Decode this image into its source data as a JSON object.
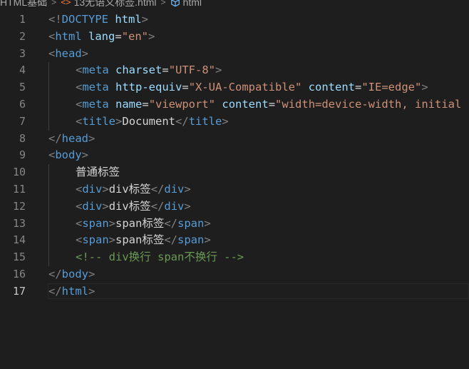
{
  "breadcrumb": {
    "folder": "HTML基础",
    "file_icon_glyph": "<>",
    "file": "13无语义标签.html",
    "symbol": "html"
  },
  "editor": {
    "active_line": 17,
    "lines": [
      {
        "num": "1",
        "indent": 0,
        "tokens": [
          [
            "t",
            "<!"
          ],
          [
            "d",
            "DOCTYPE"
          ],
          [
            "p",
            " "
          ],
          [
            "a",
            "html"
          ],
          [
            "t",
            ">"
          ]
        ]
      },
      {
        "num": "2",
        "indent": 0,
        "tokens": [
          [
            "t",
            "<"
          ],
          [
            "n",
            "html"
          ],
          [
            "p",
            " "
          ],
          [
            "a",
            "lang"
          ],
          [
            "p",
            "="
          ],
          [
            "s",
            "\"en\""
          ],
          [
            "t",
            ">"
          ]
        ]
      },
      {
        "num": "3",
        "indent": 0,
        "tokens": [
          [
            "t",
            "<"
          ],
          [
            "n",
            "head"
          ],
          [
            "t",
            ">"
          ]
        ]
      },
      {
        "num": "4",
        "indent": 1,
        "tokens": [
          [
            "t",
            "<"
          ],
          [
            "n",
            "meta"
          ],
          [
            "p",
            " "
          ],
          [
            "a",
            "charset"
          ],
          [
            "p",
            "="
          ],
          [
            "s",
            "\"UTF-8\""
          ],
          [
            "t",
            ">"
          ]
        ]
      },
      {
        "num": "5",
        "indent": 1,
        "tokens": [
          [
            "t",
            "<"
          ],
          [
            "n",
            "meta"
          ],
          [
            "p",
            " "
          ],
          [
            "a",
            "http-equiv"
          ],
          [
            "p",
            "="
          ],
          [
            "s",
            "\"X-UA-Compatible\""
          ],
          [
            "p",
            " "
          ],
          [
            "a",
            "content"
          ],
          [
            "p",
            "="
          ],
          [
            "s",
            "\"IE=edge\""
          ],
          [
            "t",
            ">"
          ]
        ]
      },
      {
        "num": "6",
        "indent": 1,
        "tokens": [
          [
            "t",
            "<"
          ],
          [
            "n",
            "meta"
          ],
          [
            "p",
            " "
          ],
          [
            "a",
            "name"
          ],
          [
            "p",
            "="
          ],
          [
            "s",
            "\"viewport\""
          ],
          [
            "p",
            " "
          ],
          [
            "a",
            "content"
          ],
          [
            "p",
            "="
          ],
          [
            "s",
            "\"width=device-width, initial"
          ]
        ]
      },
      {
        "num": "7",
        "indent": 1,
        "tokens": [
          [
            "t",
            "<"
          ],
          [
            "n",
            "title"
          ],
          [
            "t",
            ">"
          ],
          [
            "p",
            "Document"
          ],
          [
            "t",
            "</"
          ],
          [
            "n",
            "title"
          ],
          [
            "t",
            ">"
          ]
        ]
      },
      {
        "num": "8",
        "indent": 0,
        "tokens": [
          [
            "t",
            "</"
          ],
          [
            "n",
            "head"
          ],
          [
            "t",
            ">"
          ]
        ]
      },
      {
        "num": "9",
        "indent": 0,
        "tokens": [
          [
            "t",
            "<"
          ],
          [
            "n",
            "body"
          ],
          [
            "t",
            ">"
          ]
        ]
      },
      {
        "num": "10",
        "indent": 1,
        "tokens": [
          [
            "p",
            "普通标签"
          ]
        ]
      },
      {
        "num": "11",
        "indent": 1,
        "tokens": [
          [
            "t",
            "<"
          ],
          [
            "n",
            "div"
          ],
          [
            "t",
            ">"
          ],
          [
            "p",
            "div标签"
          ],
          [
            "t",
            "</"
          ],
          [
            "n",
            "div"
          ],
          [
            "t",
            ">"
          ]
        ]
      },
      {
        "num": "12",
        "indent": 1,
        "tokens": [
          [
            "t",
            "<"
          ],
          [
            "n",
            "div"
          ],
          [
            "t",
            ">"
          ],
          [
            "p",
            "div标签"
          ],
          [
            "t",
            "</"
          ],
          [
            "n",
            "div"
          ],
          [
            "t",
            ">"
          ]
        ]
      },
      {
        "num": "13",
        "indent": 1,
        "tokens": [
          [
            "t",
            "<"
          ],
          [
            "n",
            "span"
          ],
          [
            "t",
            ">"
          ],
          [
            "p",
            "span标签"
          ],
          [
            "t",
            "</"
          ],
          [
            "n",
            "span"
          ],
          [
            "t",
            ">"
          ]
        ]
      },
      {
        "num": "14",
        "indent": 1,
        "tokens": [
          [
            "t",
            "<"
          ],
          [
            "n",
            "span"
          ],
          [
            "t",
            ">"
          ],
          [
            "p",
            "span标签"
          ],
          [
            "t",
            "</"
          ],
          [
            "n",
            "span"
          ],
          [
            "t",
            ">"
          ]
        ]
      },
      {
        "num": "15",
        "indent": 1,
        "tokens": [
          [
            "c",
            "<!-- div换行 span不换行 -->"
          ]
        ]
      },
      {
        "num": "16",
        "indent": 0,
        "tokens": [
          [
            "t",
            "</"
          ],
          [
            "n",
            "body"
          ],
          [
            "t",
            ">"
          ]
        ]
      },
      {
        "num": "17",
        "indent": 0,
        "tokens": [
          [
            "t",
            "</"
          ],
          [
            "n",
            "html"
          ],
          [
            "t",
            ">"
          ]
        ]
      }
    ]
  },
  "colors": {
    "background": "#1e1e1e",
    "tag": "#569cd6",
    "attribute": "#9cdcfe",
    "string": "#ce9178",
    "comment": "#6a9955",
    "bracket": "#808080",
    "line_number": "#858585"
  }
}
